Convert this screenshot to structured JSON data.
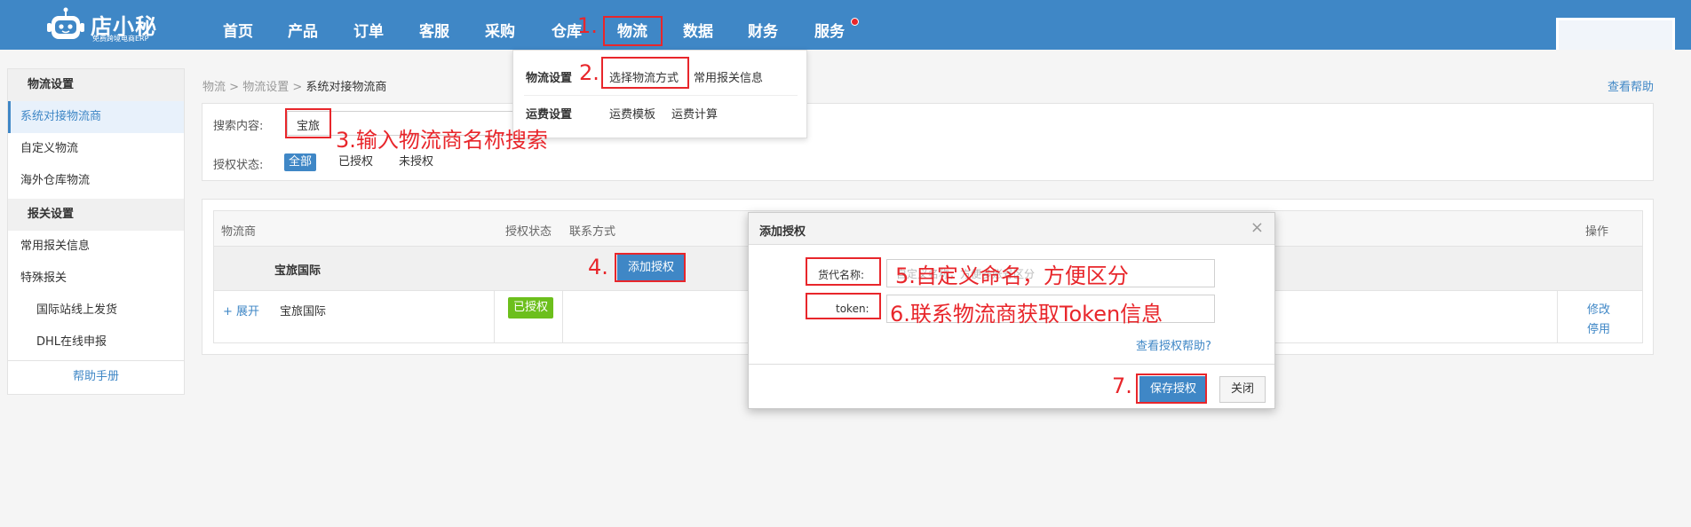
{
  "logo": {
    "name": "店小秘",
    "subtitle": "免费跨境电商ERP"
  },
  "nav": [
    "首页",
    "产品",
    "订单",
    "客服",
    "采购",
    "仓库",
    "物流",
    "数据",
    "财务",
    "服务"
  ],
  "sidebar": {
    "group1": "物流设置",
    "items1": [
      "系统对接物流商",
      "自定义物流",
      "海外仓库物流"
    ],
    "group2": "报关设置",
    "items2": [
      "常用报关信息",
      "特殊报关"
    ],
    "sub_items": [
      "国际站线上发货",
      "DHL在线申报"
    ],
    "help": "帮助手册"
  },
  "breadcrumb": {
    "a": "物流",
    "b": "物流设置",
    "c": "系统对接物流商",
    "sep": ">"
  },
  "help_link": "查看帮助",
  "search": {
    "label": "搜索内容:",
    "value": "宝旅",
    "status_label": "授权状态:",
    "options": [
      "全部",
      "已授权",
      "未授权"
    ]
  },
  "table": {
    "headers": [
      "物流商",
      "授权状态",
      "联系方式",
      "操作"
    ],
    "group_name": "宝旅国际",
    "add_auth": "添加授权",
    "row": {
      "expand": "+ 展开",
      "carrier": "宝旅国际",
      "status": "已授权",
      "ops": [
        "修改",
        "停用"
      ]
    }
  },
  "dropdown": {
    "head1": "物流设置",
    "links1": [
      "选择物流方式",
      "常用报关信息"
    ],
    "head2": "运费设置",
    "links2": [
      "运费模板",
      "运费计算"
    ]
  },
  "modal": {
    "title": "添加授权",
    "close": "×",
    "field1_label": "货代名称:",
    "field1_placeholder": "自定义名称，方便多账号区分",
    "field2_label": "token:",
    "help": "查看授权帮助?",
    "save": "保存授权",
    "cancel": "关闭"
  },
  "annotations": {
    "a1": "1.",
    "a2": "2.",
    "a3": "3.输入物流商名称搜索",
    "a4": "4.",
    "a5": "5.自定义命名，方便区分",
    "a6": "6.联系物流商获取Token信息",
    "a7": "7."
  },
  "colors": {
    "brand": "#3f87c6",
    "annotation": "#e8262b",
    "authorized": "#6cbf1c"
  }
}
